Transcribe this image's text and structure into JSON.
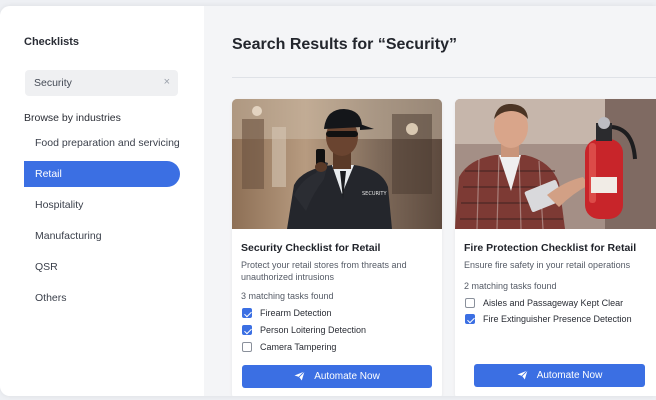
{
  "sidebar": {
    "title": "Checklists",
    "search": {
      "value": "Security",
      "clear_glyph": "×"
    },
    "browse_label": "Browse by industries",
    "items": [
      {
        "label": "Food preparation and servicing",
        "active": false
      },
      {
        "label": "Retail",
        "active": true
      },
      {
        "label": "Hospitality",
        "active": false
      },
      {
        "label": "Manufacturing",
        "active": false
      },
      {
        "label": "QSR",
        "active": false
      },
      {
        "label": "Others",
        "active": false
      }
    ]
  },
  "main": {
    "title": "Search Results for “Security”",
    "cards": [
      {
        "title": "Security Checklist for Retail",
        "description": "Protect your retail stores from threats and unauthorized intrusions",
        "matches": "3 matching tasks found",
        "tasks": [
          {
            "label": "Firearm Detection",
            "checked": true
          },
          {
            "label": "Person Loitering Detection",
            "checked": true
          },
          {
            "label": "Camera Tampering",
            "checked": false
          }
        ],
        "button": "Automate Now",
        "image": "security-guard-photo",
        "jacket_text": "SECURITY"
      },
      {
        "title": "Fire Protection Checklist for Retail",
        "description": "Ensure fire safety in your retail operations",
        "matches": "2 matching tasks found",
        "tasks": [
          {
            "label": "Aisles and Passageway Kept Clear",
            "checked": false
          },
          {
            "label": "Fire Extinguisher Presence Detection",
            "checked": true
          }
        ],
        "button": "Automate Now",
        "image": "fire-extinguisher-inspection-photo"
      }
    ]
  },
  "colors": {
    "accent": "#3b6fe3",
    "background": "#f4f5f7"
  },
  "icons": {
    "clear": "close-icon",
    "button": "send-icon"
  }
}
